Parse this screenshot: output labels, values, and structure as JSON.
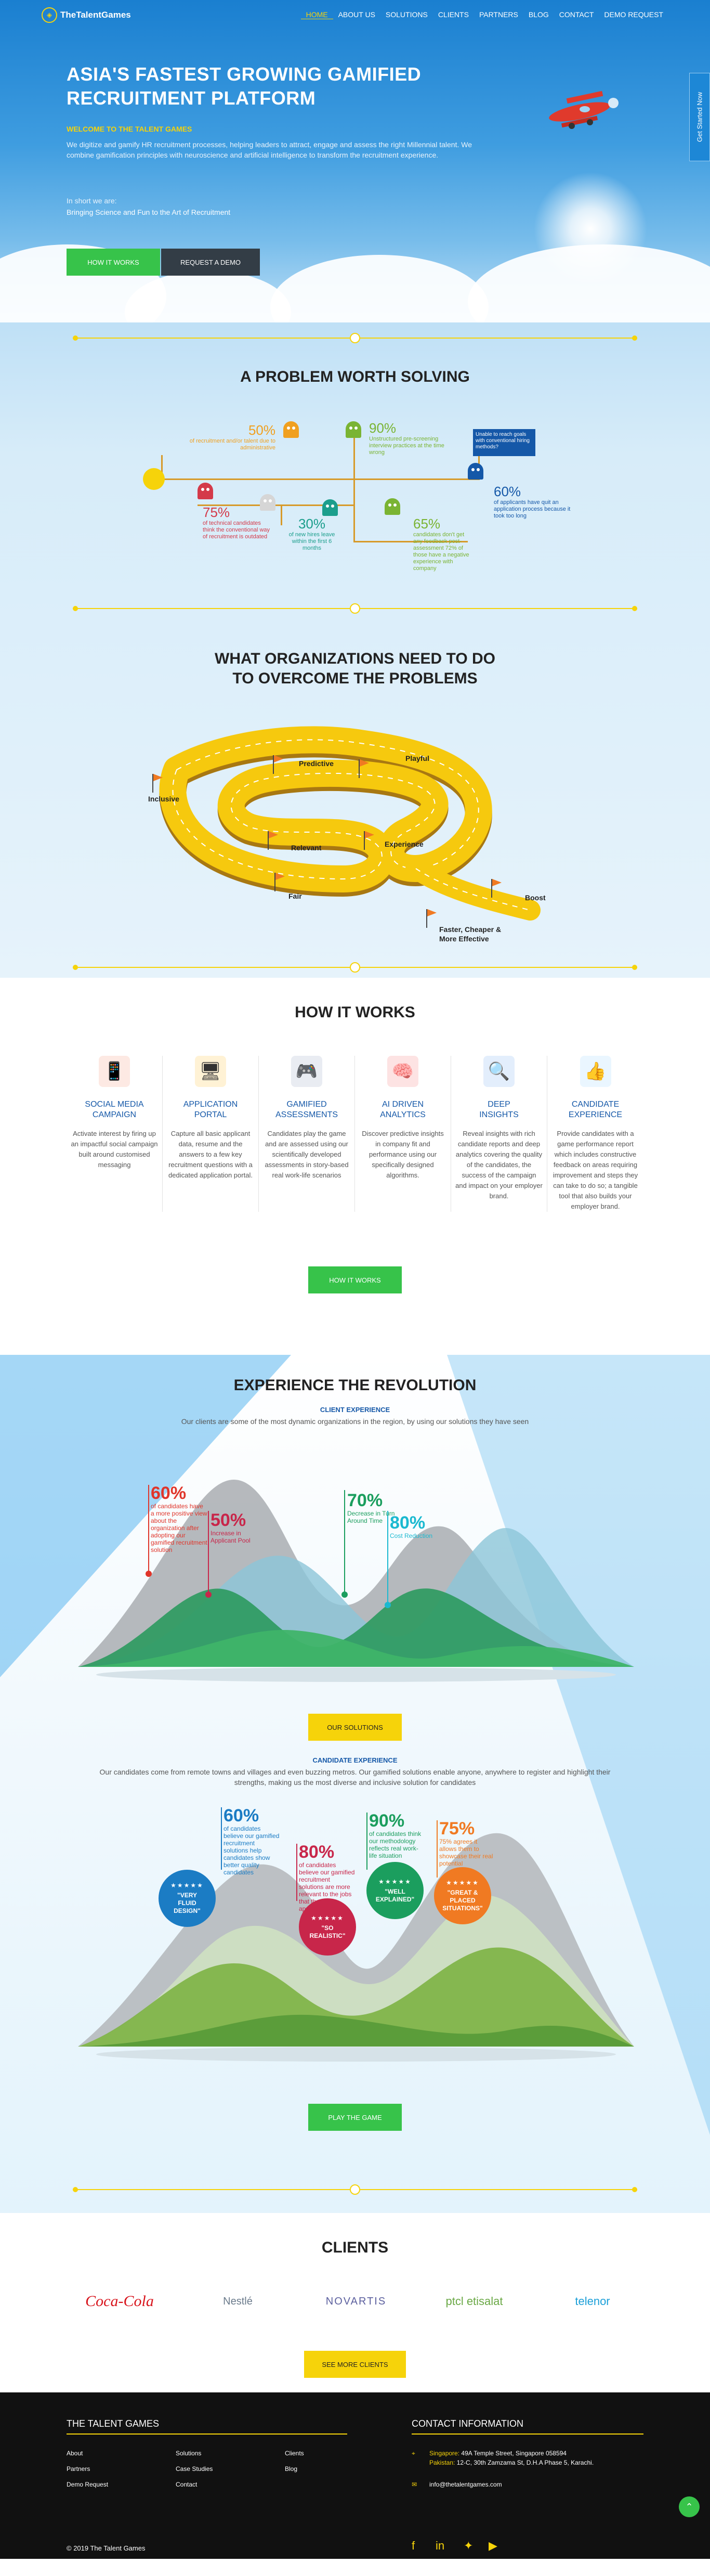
{
  "nav": {
    "logo": "TheTalentGames",
    "items": [
      "HOME",
      "ABOUT US",
      "SOLUTIONS",
      "CLIENTS",
      "PARTNERS",
      "BLOG",
      "CONTACT",
      "DEMO REQUEST"
    ],
    "active": "HOME"
  },
  "hero": {
    "title_line1": "ASIA'S FASTEST GROWING GAMIFIED",
    "title_line2": "RECRUITMENT PLATFORM",
    "welcome": "WELCOME TO THE TALENT GAMES",
    "description": "We digitize and gamify HR recruitment processes, helping leaders to attract, engage and assess the right Millennial talent. We combine gamification principles with neuroscience and artificial intelligence to transform the recruitment experience.",
    "short_label": "In short we are:",
    "tagline": "Bringing Science and Fun to the Art of Recruitment",
    "btn_how": "HOW IT WORKS",
    "btn_demo": "REQUEST A DEMO",
    "side_tab": "Get Started Now"
  },
  "problem": {
    "title": "A PROBLEM WORTH SOLVING",
    "stats": [
      {
        "num": "50%",
        "text": "of recruitment and/or talent due to administrative",
        "color": "#f0a020"
      },
      {
        "num": "90%",
        "text": "Unstructured pre-screening interview practices at the time wrong",
        "color": "#7ab433"
      },
      {
        "num": "75%",
        "text": "of technical candidates think the conventional way of recruitment is outdated",
        "color": "#d43a4a"
      },
      {
        "num": "30%",
        "text": "of new hires leave within the first 6 months",
        "color": "#1b9e8c"
      },
      {
        "num": "65%",
        "text": "candidates don't get any feedback post-assessment 72% of those have a negative experience with company",
        "color": "#7ab433"
      },
      {
        "num": "60%",
        "text": "of applicants have quit an application process because it took too long",
        "color": "#1558a8"
      }
    ],
    "callout": "Unable to reach goals with conventional hiring methods?"
  },
  "roadmap": {
    "title_line1": "WHAT ORGANIZATIONS NEED TO DO",
    "title_line2": "TO OVERCOME THE PROBLEMS",
    "labels": [
      "Predictive",
      "Playful",
      "Inclusive",
      "Relevant",
      "Experience",
      "Fair",
      "Boost",
      "Faster, Cheaper &",
      "More Effective"
    ]
  },
  "how": {
    "title": "HOW IT WORKS",
    "items": [
      {
        "icon": "social-media-icon",
        "title1": "SOCIAL MEDIA",
        "title2": "CAMPAIGN",
        "text": "Activate interest by firing up an impactful social campaign built around customised messaging",
        "bg": "#fde9e3",
        "glyph": "📱"
      },
      {
        "icon": "portal-icon",
        "title1": "APPLICATION",
        "title2": "PORTAL",
        "text": "Capture all basic applicant data, resume and the answers to a few key recruitment questions with a dedicated application portal.",
        "bg": "#fff2d5",
        "glyph": "🖥"
      },
      {
        "icon": "gamepad-icon",
        "title1": "GAMIFIED",
        "title2": "ASSESSMENTS",
        "text": "Candidates play the game and are assessed using our scientifically developed assessments in story-based real work-life scenarios",
        "bg": "#e9ecf2",
        "glyph": "🎮"
      },
      {
        "icon": "brain-icon",
        "title1": "AI DRIVEN",
        "title2": "ANALYTICS",
        "text": "Discover predictive insights in company fit and performance using our specifically designed algorithms.",
        "bg": "#fde3e3",
        "glyph": "🧠"
      },
      {
        "icon": "magnifier-icon",
        "title1": "DEEP",
        "title2": "INSIGHTS",
        "text": "Reveal insights with rich candidate reports and deep analytics covering the quality of the candidates, the success of the campaign and impact on your employer brand.",
        "bg": "#e3eefc",
        "glyph": "🔍"
      },
      {
        "icon": "thumbs-up-icon",
        "title1": "CANDIDATE",
        "title2": "EXPERIENCE",
        "text": "Provide candidates with a game performance report which includes constructive feedback on areas requiring improvement and steps they can take to do so; a tangible tool that also builds your employer brand.",
        "bg": "#eaf6ff",
        "glyph": "👍"
      }
    ],
    "button": "HOW IT WORKS"
  },
  "revolution": {
    "title": "EXPERIENCE THE REVOLUTION",
    "client_sub": "CLIENT EXPERIENCE",
    "client_text": "Our clients are some of the most dynamic organizations in the region, by using our solutions they have seen",
    "client_stats": [
      {
        "num": "60%",
        "text": "of candidates have a more positive view about the organization after adopting our gamified recruitment solution",
        "color": "#e0352a"
      },
      {
        "num": "50%",
        "text": "Increase in Applicant Pool",
        "color": "#c8264a"
      },
      {
        "num": "70%",
        "text": "Decrease in Turn Around Time",
        "color": "#1b9e5e"
      },
      {
        "num": "80%",
        "text": "Cost Reduction",
        "color": "#1bb9d0"
      }
    ],
    "solutions_button": "OUR SOLUTIONS",
    "candidate_sub": "CANDIDATE EXPERIENCE",
    "candidate_text_1": "Our candidates come from remote towns and villages and even buzzing metros. Our gamified solutions enable anyone, anywhere to register and highlight their",
    "candidate_text_2": "strengths, making us the most diverse and inclusive solution for candidates",
    "candidate_stats": [
      {
        "num": "60%",
        "text": "of candidates believe our gamified recruitment solutions help candidates show better quality candidates",
        "color": "#1b7cc4"
      },
      {
        "num": "80%",
        "text": "of candidates believe our gamified recruitment solutions are more relevant to the jobs that they are applying for",
        "color": "#c8264a"
      },
      {
        "num": "90%",
        "text": "of candidates think our methodology reflects real work-life situation",
        "color": "#1b9e5e"
      },
      {
        "num": "75%",
        "text": "75% agrees it allows them to showcase their real potential",
        "color": "#f07a22"
      }
    ],
    "bubbles": [
      {
        "label1": "\"VERY",
        "label2": "FLUID",
        "label3": "DESIGN\"",
        "color": "#1b7cc4"
      },
      {
        "label1": "\"SO",
        "label2": "REALISTIC\"",
        "label3": "",
        "color": "#c8264a"
      },
      {
        "label1": "\"WELL",
        "label2": "EXPLAINED\"",
        "label3": "",
        "color": "#1b9e5e"
      },
      {
        "label1": "\"GREAT &",
        "label2": "PLACED",
        "label3": "SITUATIONS\"",
        "color": "#f07a22"
      }
    ],
    "stars": "★★★★★",
    "game_button": "PLAY THE GAME"
  },
  "clients": {
    "title": "CLIENTS",
    "logos": [
      {
        "name": "coca-cola-logo",
        "text": "Coca-Cola",
        "color": "#d8141c"
      },
      {
        "name": "nestle-logo",
        "text": "Nestlé",
        "color": "#6b7b8c"
      },
      {
        "name": "novartis-logo",
        "text": "NOVARTIS",
        "color": "#5b5f9e"
      },
      {
        "name": "ptcl-logo",
        "text": "ptcl etisalat",
        "color": "#6aa845"
      },
      {
        "name": "telenor-logo",
        "text": "telenor",
        "color": "#1b9fd8"
      }
    ],
    "button": "SEE MORE CLIENTS"
  },
  "footer": {
    "company_heading": "THE TALENT GAMES",
    "links": [
      [
        "About",
        "Solutions",
        "Clients"
      ],
      [
        "Partners",
        "Case Studies",
        "Blog"
      ],
      [
        "Demo Request",
        "Contact",
        ""
      ]
    ],
    "contact_heading": "CONTACT INFORMATION",
    "singapore_label": "Singapore:",
    "singapore": "49A Temple Street, Singapore 058594",
    "pakistan_label": "Pakistan:",
    "pakistan": "12-C, 30th Zamzama St, D.H.A Phase 5, Karachi.",
    "email": "info@thetalentgames.com",
    "copyright": "© 2019 The Talent Games"
  }
}
